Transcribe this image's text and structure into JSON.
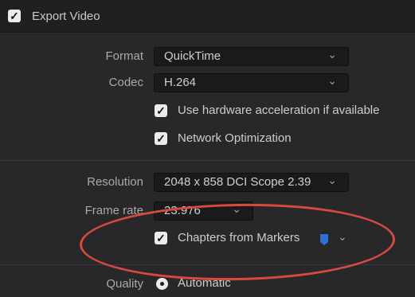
{
  "export_video": {
    "label": "Export Video",
    "checked": true
  },
  "format": {
    "label": "Format",
    "value": "QuickTime"
  },
  "codec": {
    "label": "Codec",
    "value": "H.264"
  },
  "options": {
    "hw_accel": "Use hardware acceleration if available",
    "network_opt": "Network Optimization"
  },
  "resolution": {
    "label": "Resolution",
    "value": "2048 x 858 DCI Scope 2.39"
  },
  "frame_rate": {
    "label": "Frame rate",
    "value": "23.976"
  },
  "chapters": {
    "label": "Chapters from Markers",
    "marker_color": "#2f6fd6"
  },
  "quality": {
    "label": "Quality",
    "option": "Automatic"
  },
  "icons": {
    "checkmark": "✓",
    "chevron": "⌄"
  },
  "colors": {
    "annotation": "#d9493f"
  }
}
